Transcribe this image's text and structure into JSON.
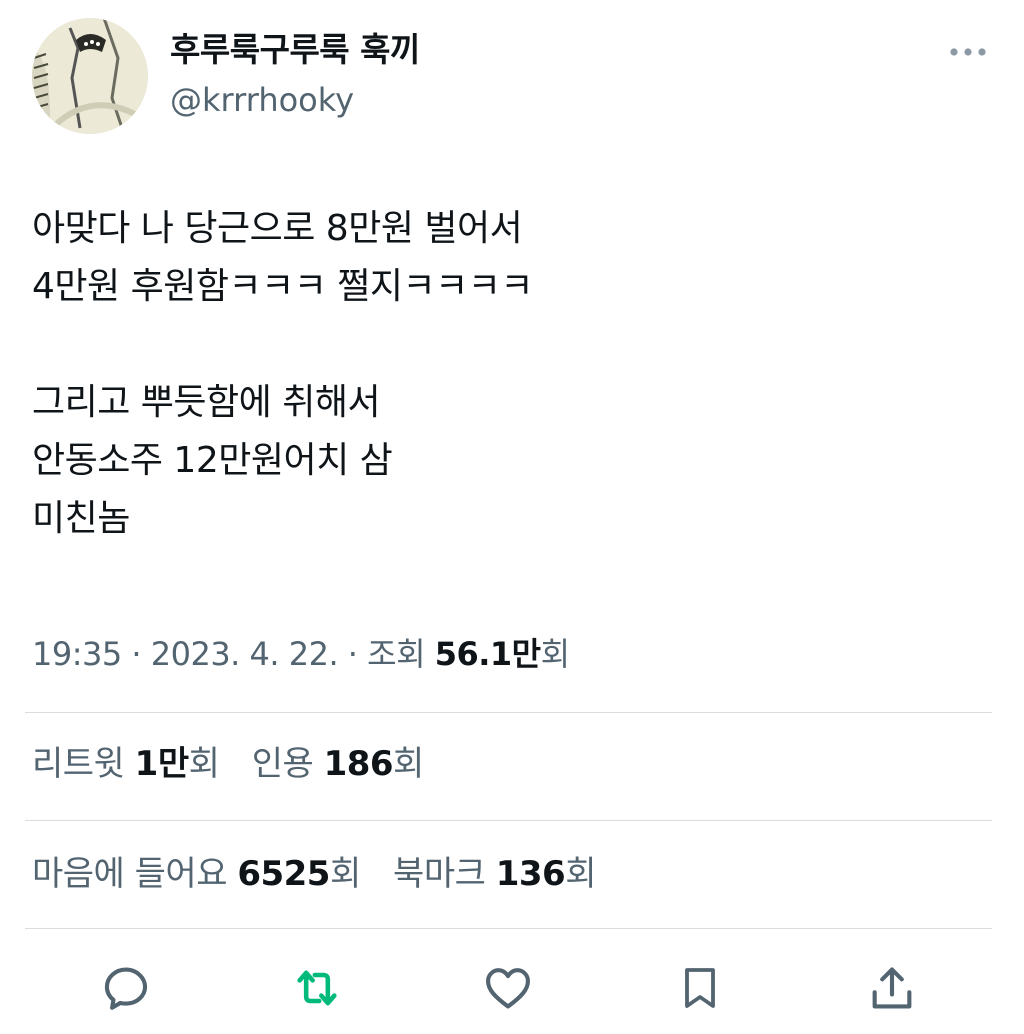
{
  "author": {
    "display_name": "후루룩구루룩 훅끼",
    "handle": "@krrrhooky",
    "avatar_icon": "profile-avatar-illustration"
  },
  "tweet": {
    "lines": [
      "아맞다 나 당근으로 8만원 벌어서",
      "4만원 후원함ㅋㅋㅋ 쩔지ㅋㅋㅋㅋ",
      "",
      "그리고 뿌듯함에 취해서",
      "안동소주 12만원어치 삼",
      "미친놈"
    ]
  },
  "meta": {
    "time": "19:35",
    "date": "2023. 4. 22.",
    "separator": "·",
    "views_label": "조회",
    "views_count": "56.1만",
    "views_suffix": "회"
  },
  "stats": {
    "retweets_label": "리트윗",
    "retweets_count": "1만",
    "quotes_label": "인용",
    "quotes_count": "186",
    "likes_label": "마음에 들어요",
    "likes_count": "6525",
    "bookmarks_label": "북마크",
    "bookmarks_count": "136",
    "suffix": "회"
  },
  "actions": [
    "reply-icon",
    "retweet-icon",
    "like-icon",
    "bookmark-icon",
    "share-icon"
  ],
  "colors": {
    "text": "#0f1419",
    "secondary": "#536471",
    "retweet_green": "#00ba7c",
    "divider": "#d9dde0"
  }
}
